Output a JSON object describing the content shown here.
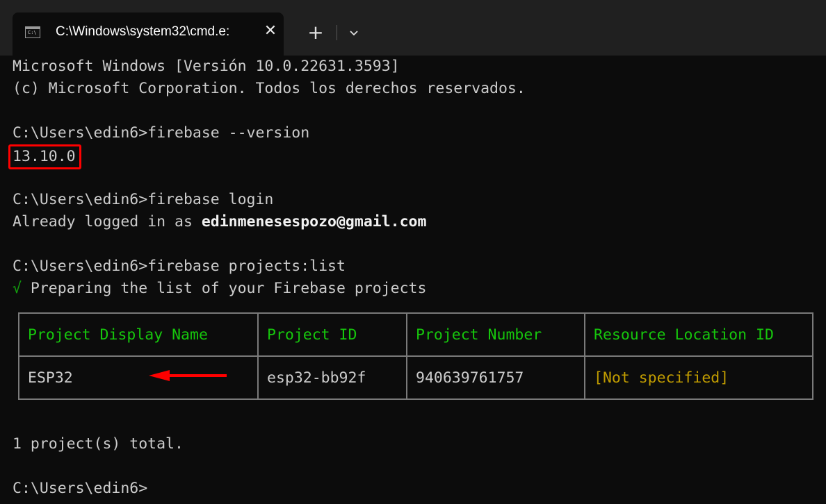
{
  "tab": {
    "title": "C:\\Windows\\system32\\cmd.e:",
    "icon": "cmd-icon",
    "icon_text": "C:\\",
    "close": "✕",
    "new_tab": "+",
    "dropdown": "chevron-down-icon"
  },
  "terminal": {
    "lines": {
      "banner1": "Microsoft Windows [Versión 10.0.22631.3593]",
      "banner2": "(c) Microsoft Corporation. Todos los derechos reservados.",
      "cmd1": "C:\\Users\\edin6>firebase --version",
      "version": "13.10.0",
      "cmd2": "C:\\Users\\edin6>firebase login",
      "logged_prefix": "Already logged in as ",
      "logged_email": "edinmenesespozo@gmail.com",
      "cmd3": "C:\\Users\\edin6>firebase projects:list",
      "check": "√",
      "preparing": " Preparing the list of your Firebase projects",
      "summary": "1 project(s) total.",
      "prompt": "C:\\Users\\edin6>"
    },
    "table": {
      "headers": [
        "Project Display Name",
        "Project ID",
        "Project Number",
        "Resource Location ID"
      ],
      "rows": [
        [
          "ESP32",
          "esp32-bb92f",
          "940639761757",
          "[Not specified]"
        ]
      ]
    },
    "annotations": {
      "highlight_color": "#ff0000",
      "arrow_color": "#ff0000"
    },
    "colors": {
      "background": "#0c0c0c",
      "text": "#cccccc",
      "header_green": "#16c60c",
      "check_green": "#13a10e",
      "not_specified_yellow": "#c19c00"
    }
  }
}
